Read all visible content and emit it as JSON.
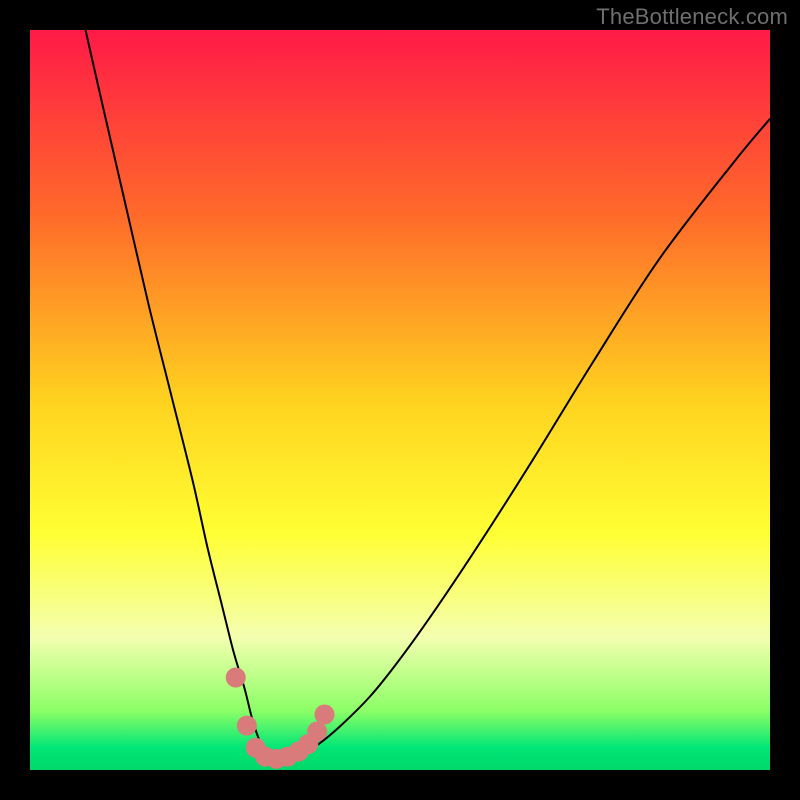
{
  "watermark": "TheBottleneck.com",
  "chart_data": {
    "type": "line",
    "title": "",
    "xlabel": "",
    "ylabel": "",
    "xlim": [
      0,
      100
    ],
    "ylim": [
      0,
      100
    ],
    "grid": false,
    "legend": false,
    "background_gradient": {
      "stops": [
        {
          "pos": 0.0,
          "color": "#ff1a47"
        },
        {
          "pos": 0.25,
          "color": "#ff6a2a"
        },
        {
          "pos": 0.5,
          "color": "#ffd21f"
        },
        {
          "pos": 0.68,
          "color": "#ffff33"
        },
        {
          "pos": 0.82,
          "color": "#f4ffb0"
        },
        {
          "pos": 0.92,
          "color": "#8cff66"
        },
        {
          "pos": 0.97,
          "color": "#00e676"
        },
        {
          "pos": 1.0,
          "color": "#00d869"
        }
      ]
    },
    "series": [
      {
        "name": "bottleneck-curve",
        "color": "#000000",
        "stroke_width": 2,
        "x": [
          7.5,
          10,
          13,
          16,
          19,
          22,
          24,
          26,
          27.5,
          29,
          30,
          31,
          32,
          33,
          34.5,
          36.5,
          39,
          42,
          46,
          50,
          55,
          61,
          68,
          76,
          85,
          95,
          100
        ],
        "y": [
          100,
          89,
          76,
          63,
          51,
          39,
          30,
          22,
          16,
          11,
          7,
          4,
          2,
          1.5,
          1.5,
          2,
          3.5,
          6,
          10,
          15,
          22,
          31,
          42,
          55,
          69,
          82,
          88
        ]
      }
    ],
    "markers": {
      "name": "highlight-dots",
      "color": "#d97b7b",
      "radius": 10,
      "points": [
        {
          "x": 27.8,
          "y": 12.5
        },
        {
          "x": 29.3,
          "y": 6.0
        },
        {
          "x": 30.5,
          "y": 3.0
        },
        {
          "x": 31.8,
          "y": 1.8
        },
        {
          "x": 33.3,
          "y": 1.5
        },
        {
          "x": 34.8,
          "y": 1.8
        },
        {
          "x": 36.3,
          "y": 2.5
        },
        {
          "x": 37.6,
          "y": 3.5
        },
        {
          "x": 38.8,
          "y": 5.2
        },
        {
          "x": 39.8,
          "y": 7.5
        }
      ]
    }
  }
}
